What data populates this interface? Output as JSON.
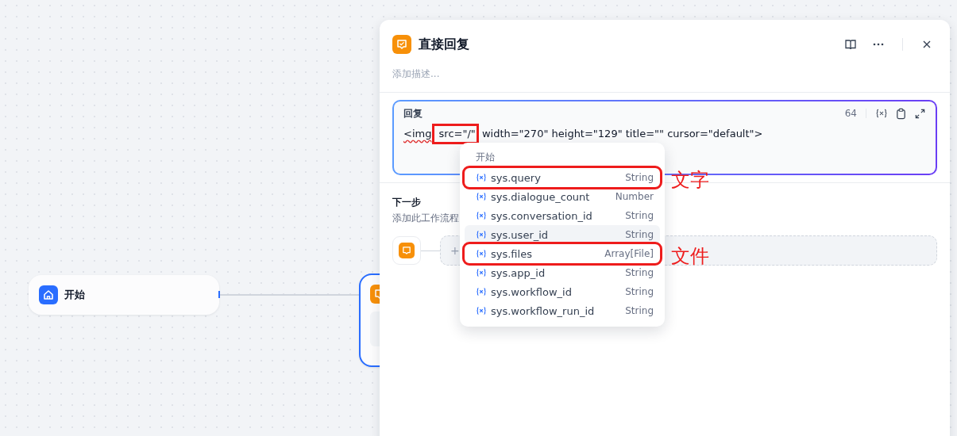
{
  "canvas": {
    "nodes": [
      {
        "kind": "start",
        "title": "开始"
      },
      {
        "kind": "answer"
      }
    ]
  },
  "panel": {
    "title": "直接回复",
    "description_placeholder": "添加描述...",
    "reply": {
      "label": "回复",
      "count": "64",
      "parts": [
        {
          "text": "<img",
          "spellcheck": true,
          "annotated": false
        },
        {
          "text": " src=\"/\"",
          "spellcheck": false,
          "annotated": true
        },
        {
          "text": " width=\"270\" height=\"129\" title=\"\" cursor=\"default\">",
          "spellcheck": false,
          "annotated": false
        }
      ]
    },
    "next_step": {
      "title": "下一步",
      "subtitle": "添加此工作流程",
      "add": "+"
    }
  },
  "dropdown": {
    "group": "开始",
    "items": [
      {
        "name": "sys.query",
        "type": "String",
        "selected": false,
        "annotated": true,
        "annotation": "文字"
      },
      {
        "name": "sys.dialogue_count",
        "type": "Number",
        "selected": false,
        "annotated": false
      },
      {
        "name": "sys.conversation_id",
        "type": "String",
        "selected": false,
        "annotated": false
      },
      {
        "name": "sys.user_id",
        "type": "String",
        "selected": true,
        "annotated": false
      },
      {
        "name": "sys.files",
        "type": "Array[File]",
        "selected": false,
        "annotated": true,
        "annotation": "文件"
      },
      {
        "name": "sys.app_id",
        "type": "String",
        "selected": false,
        "annotated": false
      },
      {
        "name": "sys.workflow_id",
        "type": "String",
        "selected": false,
        "annotated": false
      },
      {
        "name": "sys.workflow_run_id",
        "type": "String",
        "selected": false,
        "annotated": false
      }
    ]
  }
}
